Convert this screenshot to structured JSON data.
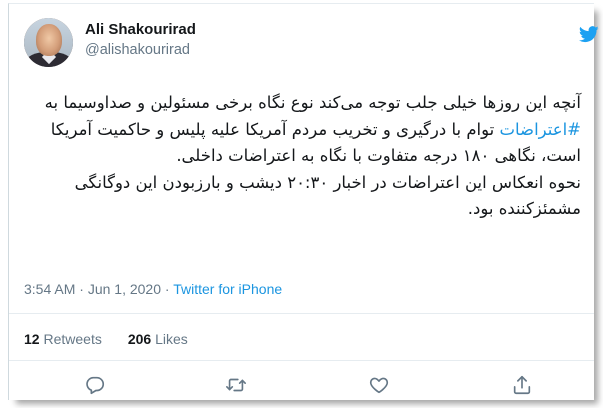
{
  "author": {
    "name": "Ali Shakourirad",
    "handle": "@alishakourirad"
  },
  "tweet": {
    "text_pre": "آنچه این روزها خیلی جلب توجه می‌کند نوع نگاه برخی مسئولین و صداوسیما به ",
    "hashtag": "#اعتراضات",
    "text_post": " توام با درگیری و تخریب مردم آمریکا علیه پلیس و حاکمیت آمریکا است، نگاهی ۱۸۰ درجه متفاوت با نگاه به اعتراضات داخلی.",
    "paragraph2": "نحوه انعکاس این اعتراضات در اخبار ۲۰:۳۰ دیشب و بارزبودن این دوگانگی مشمئزکننده بود."
  },
  "meta": {
    "time": "3:54 AM",
    "separator1": "·",
    "date": "Jun 1, 2020",
    "separator2": "·",
    "source": "Twitter for iPhone"
  },
  "stats": {
    "retweets_count": "12",
    "retweets_label": "Retweets",
    "likes_count": "206",
    "likes_label": "Likes"
  },
  "icons": {
    "brand": "twitter-bird-icon",
    "reply": "reply-icon",
    "retweet": "retweet-icon",
    "like": "heart-icon",
    "share": "share-icon"
  },
  "colors": {
    "link": "#1b95e0",
    "secondary_text": "#657786",
    "primary_text": "#14171a"
  }
}
